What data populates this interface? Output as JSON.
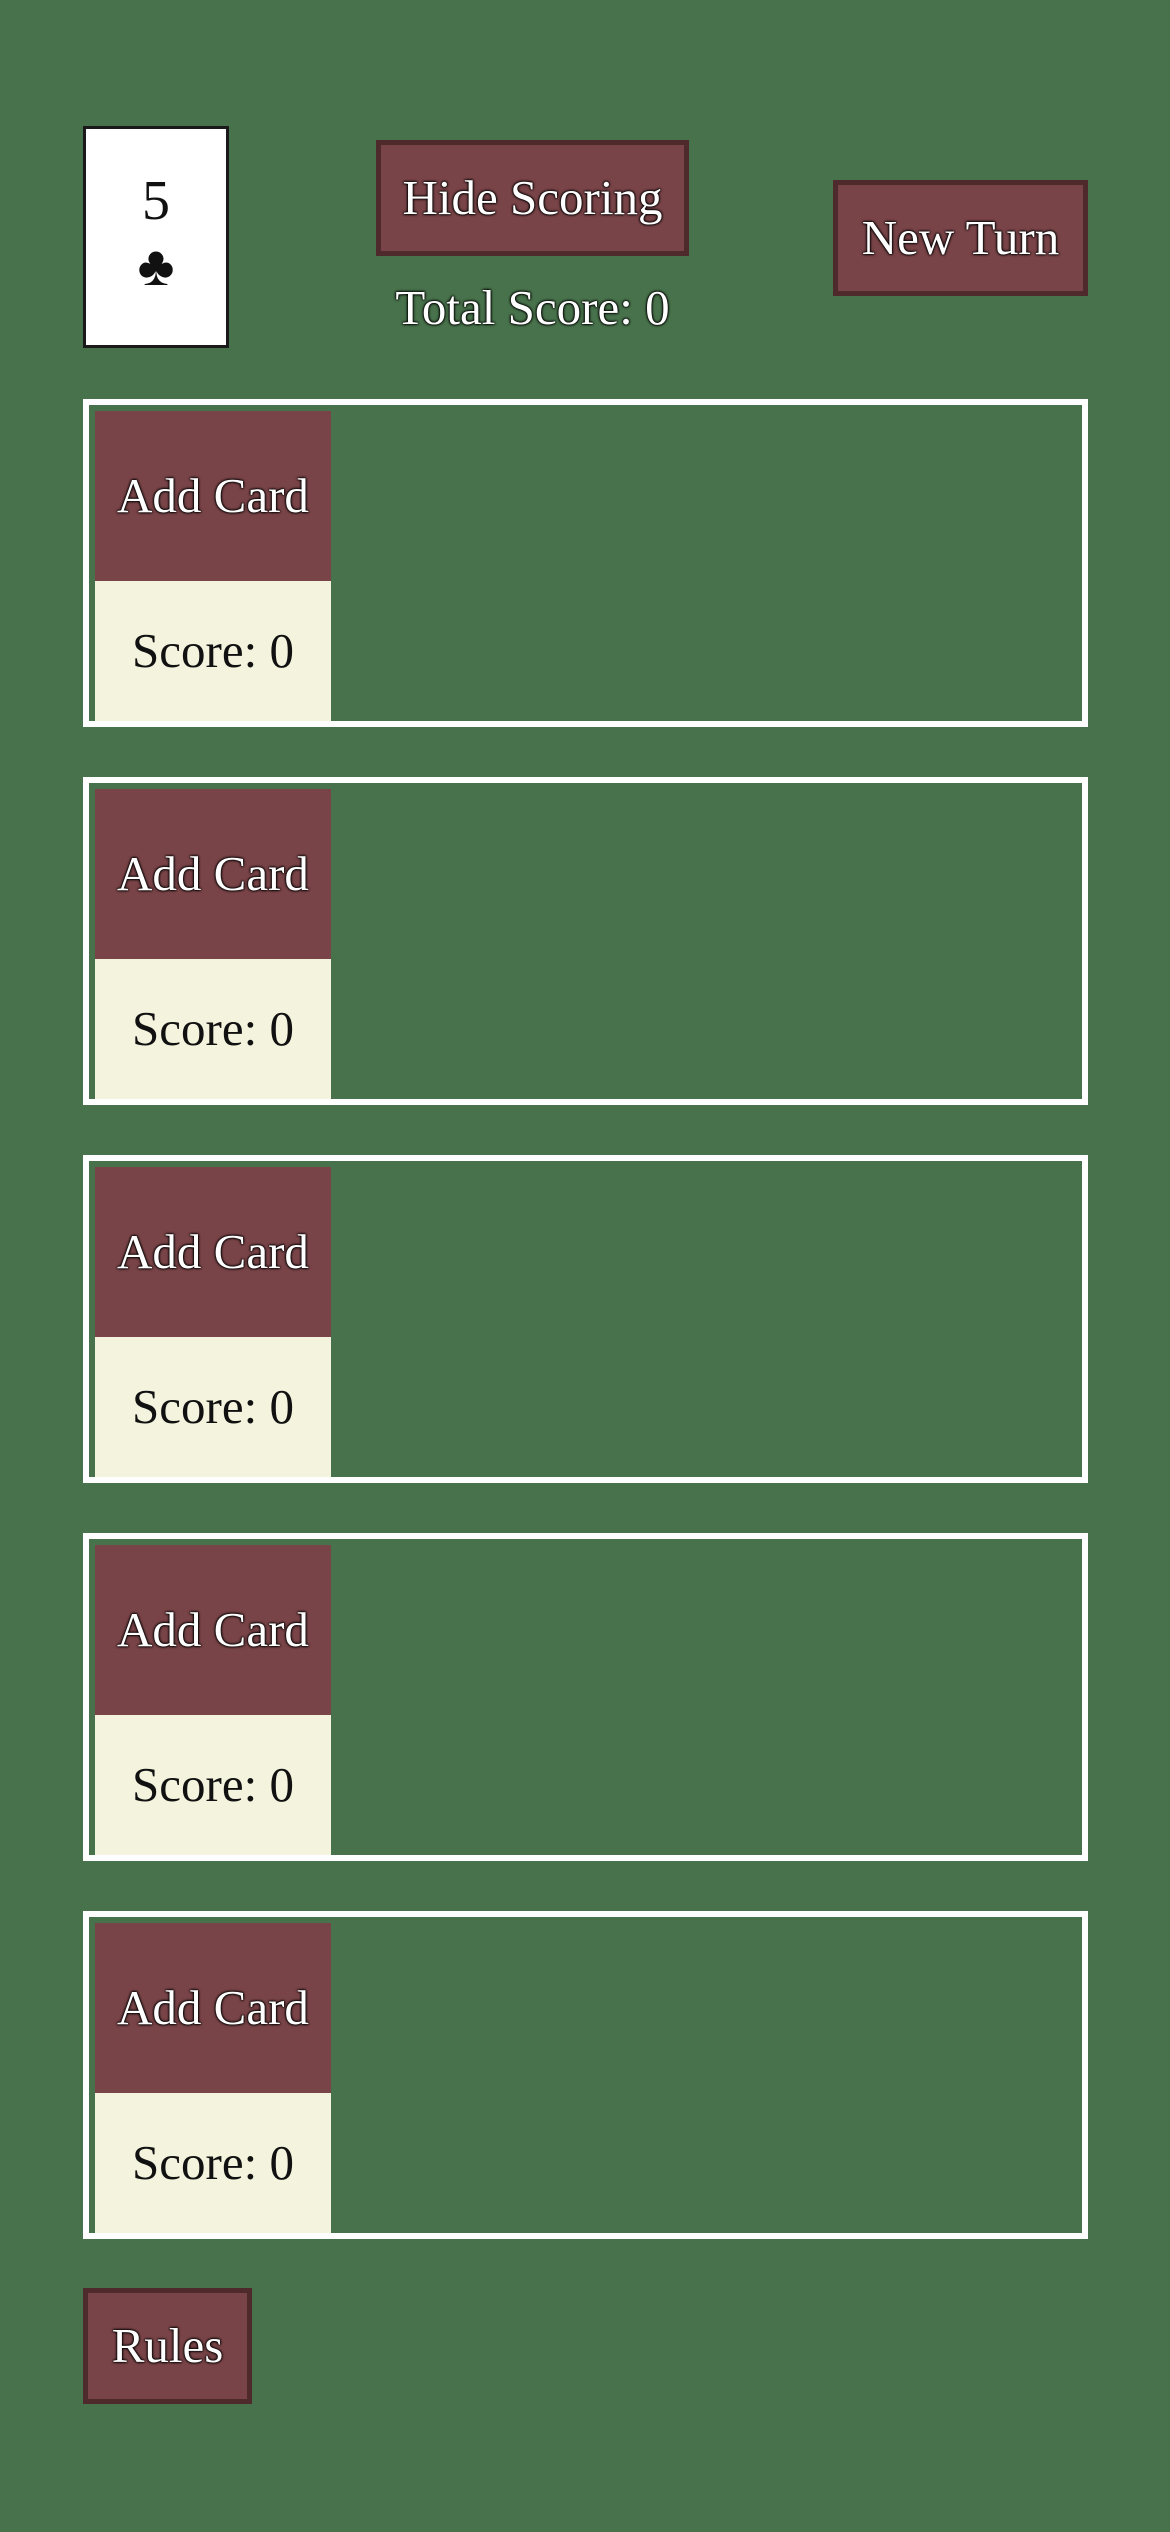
{
  "current_card": {
    "rank": "5",
    "suit": "♣"
  },
  "controls": {
    "hide_scoring_label": "Hide Scoring",
    "new_turn_label": "New Turn",
    "rules_label": "Rules"
  },
  "total_score_text": "Total Score: 0",
  "rows": [
    {
      "add_label": "Add Card",
      "score_text": "Score: 0"
    },
    {
      "add_label": "Add Card",
      "score_text": "Score: 0"
    },
    {
      "add_label": "Add Card",
      "score_text": "Score: 0"
    },
    {
      "add_label": "Add Card",
      "score_text": "Score: 0"
    },
    {
      "add_label": "Add Card",
      "score_text": "Score: 0"
    }
  ],
  "colors": {
    "table_green": "#48724b",
    "button_maroon": "#794448",
    "score_cream": "#f4f3dd"
  }
}
